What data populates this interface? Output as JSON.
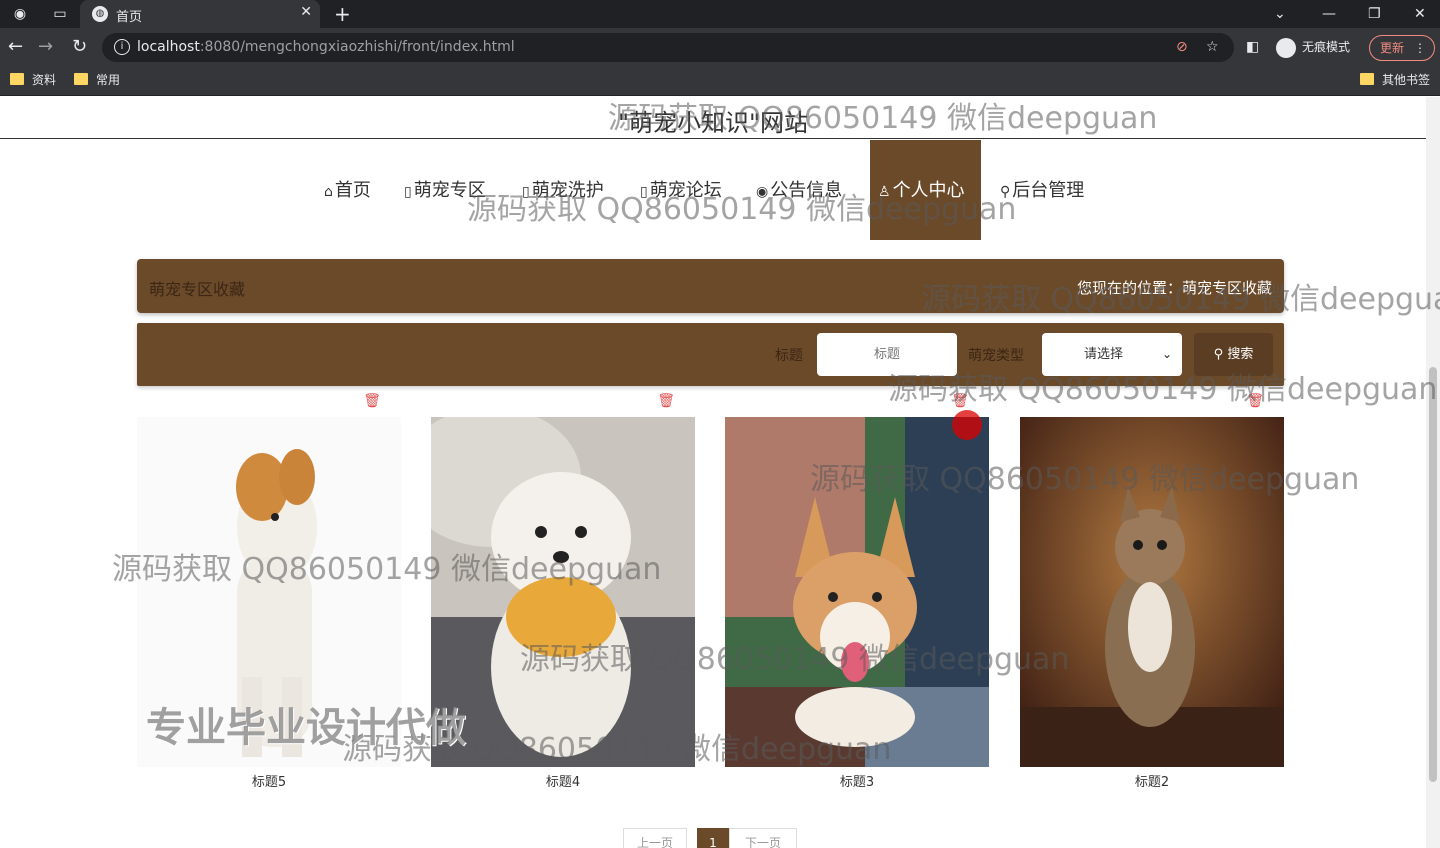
{
  "browser": {
    "tab_title": "首页",
    "url_host": "localhost",
    "url_rest": ":8080/mengchongxiaozhishi/front/index.html",
    "incognito_label": "无痕模式",
    "update_label": "更新",
    "bookmarks": [
      "资料",
      "常用"
    ],
    "other_bookmarks": "其他书签"
  },
  "site": {
    "title": "\"萌宠小知识\"网站",
    "menu": [
      {
        "icon": "⌂",
        "label": "首页"
      },
      {
        "icon": "▯",
        "label": "萌宠专区"
      },
      {
        "icon": "▯",
        "label": "萌宠洗护"
      },
      {
        "icon": "▯",
        "label": "萌宠论坛"
      },
      {
        "icon": "◉",
        "label": "公告信息"
      },
      {
        "icon": "♙",
        "label": "个人中心"
      },
      {
        "icon": "⚲",
        "label": "后台管理"
      }
    ]
  },
  "breadcrumb": {
    "left": "萌宠专区收藏",
    "right": "您现在的位置：萌宠专区收藏"
  },
  "search": {
    "title_label": "标题",
    "title_placeholder": "标题",
    "type_label": "萌宠类型",
    "type_value": "请选择",
    "button_label": "搜索"
  },
  "cards": [
    {
      "caption": "标题5"
    },
    {
      "caption": "标题4"
    },
    {
      "caption": "标题3"
    },
    {
      "caption": "标题2"
    }
  ],
  "pager": {
    "prev": "上一页",
    "current": "1",
    "next": "下一页"
  },
  "watermark": {
    "text": "源码获取 QQ86050149 微信deepguan",
    "big": "专业毕业设计代做"
  },
  "colors": {
    "brand": "#6b4a2a",
    "delete": "#e05050"
  }
}
